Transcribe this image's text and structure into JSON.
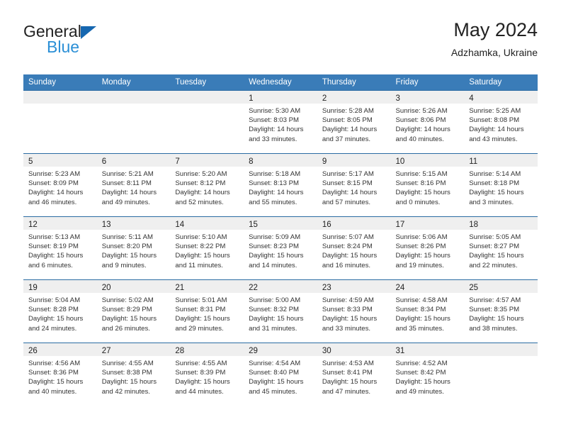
{
  "brand": {
    "name_part1": "General",
    "name_part2": "Blue",
    "logo_icon": "triangle-icon"
  },
  "header": {
    "title": "May 2024",
    "location": "Adzhamka, Ukraine"
  },
  "colors": {
    "header_blue": "#3a7cb8",
    "row_divider_blue": "#2b6ca3",
    "daynum_strip_gray": "#efefef",
    "brand_blue": "#2b8fd6",
    "logo_blue": "#1667b0"
  },
  "labels": {
    "sunrise_prefix": "Sunrise:",
    "sunset_prefix": "Sunset:",
    "daylight_prefix": "Daylight:"
  },
  "weekday_headers": [
    "Sunday",
    "Monday",
    "Tuesday",
    "Wednesday",
    "Thursday",
    "Friday",
    "Saturday"
  ],
  "weeks": [
    [
      {
        "day": "",
        "sunrise": "",
        "sunset": "",
        "daylight_line1": "",
        "daylight_line2": ""
      },
      {
        "day": "",
        "sunrise": "",
        "sunset": "",
        "daylight_line1": "",
        "daylight_line2": ""
      },
      {
        "day": "",
        "sunrise": "",
        "sunset": "",
        "daylight_line1": "",
        "daylight_line2": ""
      },
      {
        "day": "1",
        "sunrise": "Sunrise: 5:30 AM",
        "sunset": "Sunset: 8:03 PM",
        "daylight_line1": "Daylight: 14 hours",
        "daylight_line2": "and 33 minutes."
      },
      {
        "day": "2",
        "sunrise": "Sunrise: 5:28 AM",
        "sunset": "Sunset: 8:05 PM",
        "daylight_line1": "Daylight: 14 hours",
        "daylight_line2": "and 37 minutes."
      },
      {
        "day": "3",
        "sunrise": "Sunrise: 5:26 AM",
        "sunset": "Sunset: 8:06 PM",
        "daylight_line1": "Daylight: 14 hours",
        "daylight_line2": "and 40 minutes."
      },
      {
        "day": "4",
        "sunrise": "Sunrise: 5:25 AM",
        "sunset": "Sunset: 8:08 PM",
        "daylight_line1": "Daylight: 14 hours",
        "daylight_line2": "and 43 minutes."
      }
    ],
    [
      {
        "day": "5",
        "sunrise": "Sunrise: 5:23 AM",
        "sunset": "Sunset: 8:09 PM",
        "daylight_line1": "Daylight: 14 hours",
        "daylight_line2": "and 46 minutes."
      },
      {
        "day": "6",
        "sunrise": "Sunrise: 5:21 AM",
        "sunset": "Sunset: 8:11 PM",
        "daylight_line1": "Daylight: 14 hours",
        "daylight_line2": "and 49 minutes."
      },
      {
        "day": "7",
        "sunrise": "Sunrise: 5:20 AM",
        "sunset": "Sunset: 8:12 PM",
        "daylight_line1": "Daylight: 14 hours",
        "daylight_line2": "and 52 minutes."
      },
      {
        "day": "8",
        "sunrise": "Sunrise: 5:18 AM",
        "sunset": "Sunset: 8:13 PM",
        "daylight_line1": "Daylight: 14 hours",
        "daylight_line2": "and 55 minutes."
      },
      {
        "day": "9",
        "sunrise": "Sunrise: 5:17 AM",
        "sunset": "Sunset: 8:15 PM",
        "daylight_line1": "Daylight: 14 hours",
        "daylight_line2": "and 57 minutes."
      },
      {
        "day": "10",
        "sunrise": "Sunrise: 5:15 AM",
        "sunset": "Sunset: 8:16 PM",
        "daylight_line1": "Daylight: 15 hours",
        "daylight_line2": "and 0 minutes."
      },
      {
        "day": "11",
        "sunrise": "Sunrise: 5:14 AM",
        "sunset": "Sunset: 8:18 PM",
        "daylight_line1": "Daylight: 15 hours",
        "daylight_line2": "and 3 minutes."
      }
    ],
    [
      {
        "day": "12",
        "sunrise": "Sunrise: 5:13 AM",
        "sunset": "Sunset: 8:19 PM",
        "daylight_line1": "Daylight: 15 hours",
        "daylight_line2": "and 6 minutes."
      },
      {
        "day": "13",
        "sunrise": "Sunrise: 5:11 AM",
        "sunset": "Sunset: 8:20 PM",
        "daylight_line1": "Daylight: 15 hours",
        "daylight_line2": "and 9 minutes."
      },
      {
        "day": "14",
        "sunrise": "Sunrise: 5:10 AM",
        "sunset": "Sunset: 8:22 PM",
        "daylight_line1": "Daylight: 15 hours",
        "daylight_line2": "and 11 minutes."
      },
      {
        "day": "15",
        "sunrise": "Sunrise: 5:09 AM",
        "sunset": "Sunset: 8:23 PM",
        "daylight_line1": "Daylight: 15 hours",
        "daylight_line2": "and 14 minutes."
      },
      {
        "day": "16",
        "sunrise": "Sunrise: 5:07 AM",
        "sunset": "Sunset: 8:24 PM",
        "daylight_line1": "Daylight: 15 hours",
        "daylight_line2": "and 16 minutes."
      },
      {
        "day": "17",
        "sunrise": "Sunrise: 5:06 AM",
        "sunset": "Sunset: 8:26 PM",
        "daylight_line1": "Daylight: 15 hours",
        "daylight_line2": "and 19 minutes."
      },
      {
        "day": "18",
        "sunrise": "Sunrise: 5:05 AM",
        "sunset": "Sunset: 8:27 PM",
        "daylight_line1": "Daylight: 15 hours",
        "daylight_line2": "and 22 minutes."
      }
    ],
    [
      {
        "day": "19",
        "sunrise": "Sunrise: 5:04 AM",
        "sunset": "Sunset: 8:28 PM",
        "daylight_line1": "Daylight: 15 hours",
        "daylight_line2": "and 24 minutes."
      },
      {
        "day": "20",
        "sunrise": "Sunrise: 5:02 AM",
        "sunset": "Sunset: 8:29 PM",
        "daylight_line1": "Daylight: 15 hours",
        "daylight_line2": "and 26 minutes."
      },
      {
        "day": "21",
        "sunrise": "Sunrise: 5:01 AM",
        "sunset": "Sunset: 8:31 PM",
        "daylight_line1": "Daylight: 15 hours",
        "daylight_line2": "and 29 minutes."
      },
      {
        "day": "22",
        "sunrise": "Sunrise: 5:00 AM",
        "sunset": "Sunset: 8:32 PM",
        "daylight_line1": "Daylight: 15 hours",
        "daylight_line2": "and 31 minutes."
      },
      {
        "day": "23",
        "sunrise": "Sunrise: 4:59 AM",
        "sunset": "Sunset: 8:33 PM",
        "daylight_line1": "Daylight: 15 hours",
        "daylight_line2": "and 33 minutes."
      },
      {
        "day": "24",
        "sunrise": "Sunrise: 4:58 AM",
        "sunset": "Sunset: 8:34 PM",
        "daylight_line1": "Daylight: 15 hours",
        "daylight_line2": "and 35 minutes."
      },
      {
        "day": "25",
        "sunrise": "Sunrise: 4:57 AM",
        "sunset": "Sunset: 8:35 PM",
        "daylight_line1": "Daylight: 15 hours",
        "daylight_line2": "and 38 minutes."
      }
    ],
    [
      {
        "day": "26",
        "sunrise": "Sunrise: 4:56 AM",
        "sunset": "Sunset: 8:36 PM",
        "daylight_line1": "Daylight: 15 hours",
        "daylight_line2": "and 40 minutes."
      },
      {
        "day": "27",
        "sunrise": "Sunrise: 4:55 AM",
        "sunset": "Sunset: 8:38 PM",
        "daylight_line1": "Daylight: 15 hours",
        "daylight_line2": "and 42 minutes."
      },
      {
        "day": "28",
        "sunrise": "Sunrise: 4:55 AM",
        "sunset": "Sunset: 8:39 PM",
        "daylight_line1": "Daylight: 15 hours",
        "daylight_line2": "and 44 minutes."
      },
      {
        "day": "29",
        "sunrise": "Sunrise: 4:54 AM",
        "sunset": "Sunset: 8:40 PM",
        "daylight_line1": "Daylight: 15 hours",
        "daylight_line2": "and 45 minutes."
      },
      {
        "day": "30",
        "sunrise": "Sunrise: 4:53 AM",
        "sunset": "Sunset: 8:41 PM",
        "daylight_line1": "Daylight: 15 hours",
        "daylight_line2": "and 47 minutes."
      },
      {
        "day": "31",
        "sunrise": "Sunrise: 4:52 AM",
        "sunset": "Sunset: 8:42 PM",
        "daylight_line1": "Daylight: 15 hours",
        "daylight_line2": "and 49 minutes."
      },
      {
        "day": "",
        "sunrise": "",
        "sunset": "",
        "daylight_line1": "",
        "daylight_line2": ""
      }
    ]
  ]
}
